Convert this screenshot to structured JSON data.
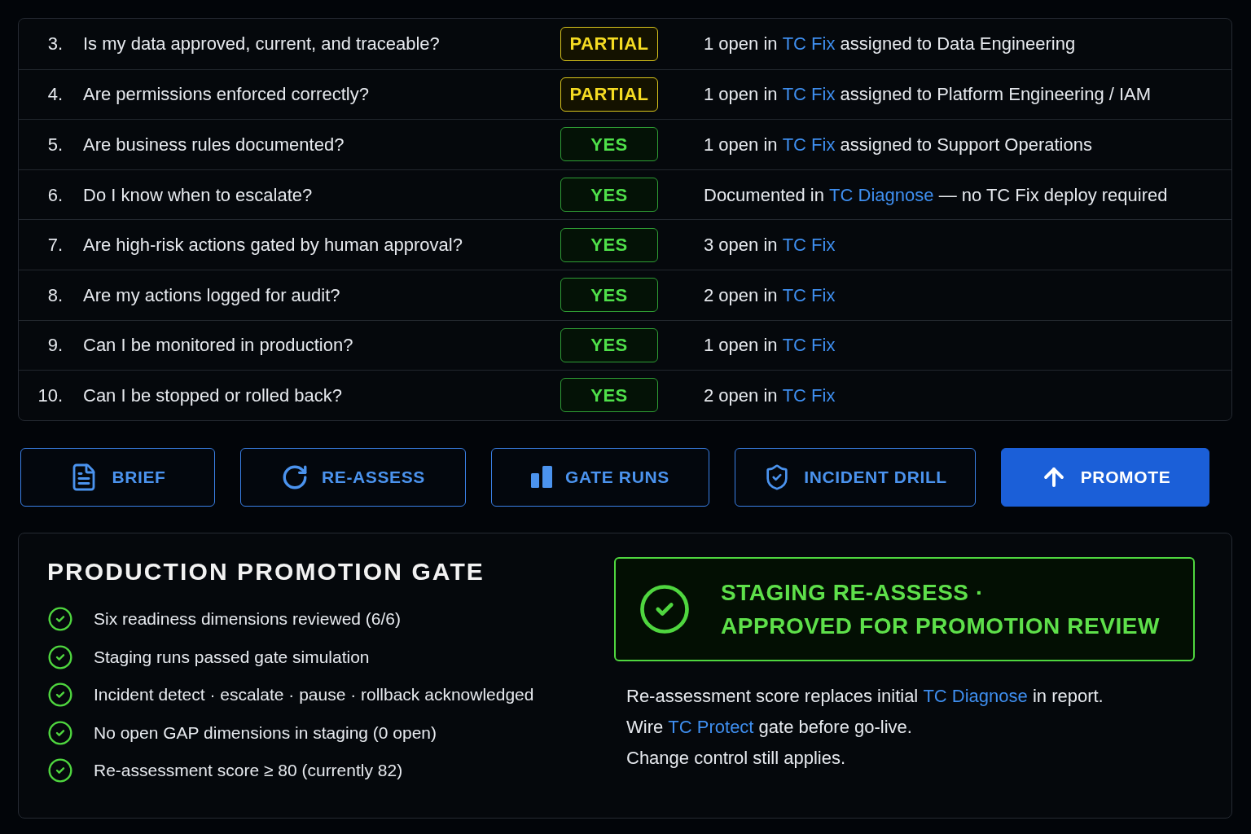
{
  "readiness_table": {
    "rows": [
      {
        "number": "3.",
        "question": "Is my data approved, current, and traceable?",
        "status": {
          "label": "PARTIAL",
          "kind": "partial"
        },
        "note": [
          {
            "kind": "text",
            "text": "1 open in"
          },
          {
            "kind": "link",
            "text": "TC Fix"
          },
          {
            "kind": "text",
            "text": "assigned to Data Engineering"
          }
        ]
      },
      {
        "number": "4.",
        "question": "Are permissions enforced correctly?",
        "status": {
          "label": "PARTIAL",
          "kind": "partial"
        },
        "note": [
          {
            "kind": "text",
            "text": "1 open in"
          },
          {
            "kind": "link",
            "text": "TC Fix"
          },
          {
            "kind": "text",
            "text": "assigned to Platform Engineering / IAM"
          }
        ]
      },
      {
        "number": "5.",
        "question": "Are business rules documented?",
        "status": {
          "label": "YES",
          "kind": "yes"
        },
        "note": [
          {
            "kind": "text",
            "text": "1 open in"
          },
          {
            "kind": "link",
            "text": "TC Fix"
          },
          {
            "kind": "text",
            "text": "assigned to Support Operations"
          }
        ]
      },
      {
        "number": "6.",
        "question": "Do I know when to escalate?",
        "status": {
          "label": "YES",
          "kind": "yes"
        },
        "note": [
          {
            "kind": "text",
            "text": "Documented in"
          },
          {
            "kind": "link",
            "text": "TC Diagnose"
          },
          {
            "kind": "text",
            "text": "— no TC Fix deploy required"
          }
        ]
      },
      {
        "number": "7.",
        "question": "Are high-risk actions gated by human approval?",
        "status": {
          "label": "YES",
          "kind": "yes"
        },
        "note": [
          {
            "kind": "text",
            "text": "3 open in"
          },
          {
            "kind": "link",
            "text": "TC Fix"
          }
        ]
      },
      {
        "number": "8.",
        "question": "Are my actions logged for audit?",
        "status": {
          "label": "YES",
          "kind": "yes"
        },
        "note": [
          {
            "kind": "text",
            "text": "2 open in"
          },
          {
            "kind": "link",
            "text": "TC Fix"
          }
        ]
      },
      {
        "number": "9.",
        "question": "Can I be monitored in production?",
        "status": {
          "label": "YES",
          "kind": "yes"
        },
        "note": [
          {
            "kind": "text",
            "text": "1 open in"
          },
          {
            "kind": "link",
            "text": "TC Fix"
          }
        ]
      },
      {
        "number": "10.",
        "question": "Can I be stopped or rolled back?",
        "status": {
          "label": "YES",
          "kind": "yes"
        },
        "note": [
          {
            "kind": "text",
            "text": "2 open in"
          },
          {
            "kind": "link",
            "text": "TC Fix"
          }
        ]
      }
    ]
  },
  "actions": [
    {
      "label": "BRIEF",
      "kind": "outline"
    },
    {
      "label": "RE-ASSESS",
      "kind": "outline"
    },
    {
      "label": "GATE RUNS",
      "kind": "outline"
    },
    {
      "label": "INCIDENT DRILL",
      "kind": "outline"
    },
    {
      "label": "PROMOTE",
      "kind": "primary"
    }
  ],
  "promotion_gate": {
    "title": "PRODUCTION PROMOTION GATE",
    "checklist": [
      {
        "text": "Six readiness dimensions reviewed (6/6)",
        "checked": true
      },
      {
        "text": "Staging runs passed gate simulation",
        "checked": true
      },
      {
        "text": "Incident detect · escalate · pause · rollback acknowledged",
        "checked": true
      },
      {
        "text": "No open GAP dimensions in staging (0 open)",
        "checked": true
      },
      {
        "text": "Re-assessment score ≥ 80 (currently 82)",
        "checked": true
      }
    ],
    "status_banner": {
      "kind": "approved",
      "lines": [
        "STAGING RE-ASSESS ·",
        "APPROVED FOR PROMOTION REVIEW"
      ]
    },
    "notes": [
      [
        {
          "kind": "text",
          "text": "Re-assessment score replaces initial"
        },
        {
          "kind": "link",
          "text": "TC Diagnose"
        },
        {
          "kind": "text",
          "text": "in report."
        }
      ],
      [
        {
          "kind": "text",
          "text": "Wire"
        },
        {
          "kind": "link",
          "text": "TC Protect"
        },
        {
          "kind": "text",
          "text": "gate before go-live."
        }
      ],
      [
        {
          "kind": "text",
          "text": "Change control still applies."
        }
      ]
    ]
  }
}
